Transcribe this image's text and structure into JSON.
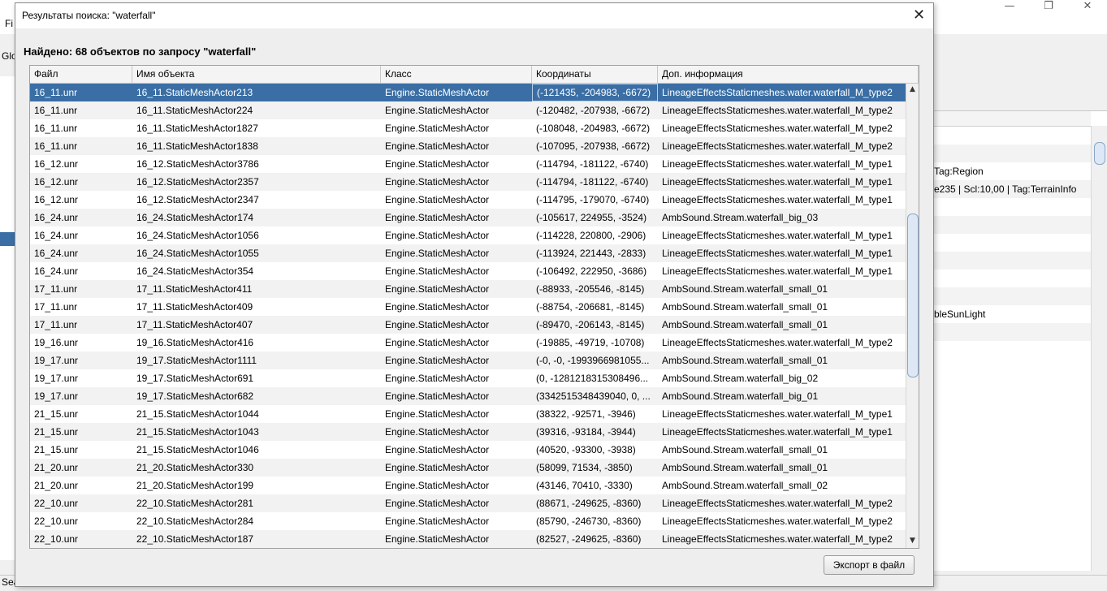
{
  "background": {
    "menu_file": "Fi",
    "toolbar_text": "Glo",
    "status_text": "Sea",
    "window_controls": [
      "—",
      "❐",
      "✕"
    ],
    "right_panel_rows": [
      {
        "text": "",
        "alt": false
      },
      {
        "text": "",
        "alt": true
      },
      {
        "text": "Tag:Region",
        "alt": false
      },
      {
        "text": "e235 | Scl:10,00 | Tag:TerrainInfo",
        "alt": true
      },
      {
        "text": "",
        "alt": false
      },
      {
        "text": "",
        "alt": true
      },
      {
        "text": "",
        "alt": false
      },
      {
        "text": "",
        "alt": true
      },
      {
        "text": "",
        "alt": false
      },
      {
        "text": "",
        "alt": true
      },
      {
        "text": "bleSunLight",
        "alt": false
      },
      {
        "text": "",
        "alt": true
      }
    ]
  },
  "dialog": {
    "title": "Результаты поиска: \"waterfall\"",
    "close_icon": "✕",
    "heading": "Найдено: 68 объектов по запросу \"waterfall\"",
    "export_label": "Экспорт в файл"
  },
  "table": {
    "columns": [
      "Файл",
      "Имя объекта",
      "Класс",
      "Координаты",
      "Доп. информация"
    ],
    "selected_row": 0,
    "rows": [
      [
        "16_11.unr",
        "16_11.StaticMeshActor213",
        "Engine.StaticMeshActor",
        "(-121435, -204983, -6672)",
        "LineageEffectsStaticmeshes.water.waterfall_M_type2"
      ],
      [
        "16_11.unr",
        "16_11.StaticMeshActor224",
        "Engine.StaticMeshActor",
        "(-120482, -207938, -6672)",
        "LineageEffectsStaticmeshes.water.waterfall_M_type2"
      ],
      [
        "16_11.unr",
        "16_11.StaticMeshActor1827",
        "Engine.StaticMeshActor",
        "(-108048, -204983, -6672)",
        "LineageEffectsStaticmeshes.water.waterfall_M_type2"
      ],
      [
        "16_11.unr",
        "16_11.StaticMeshActor1838",
        "Engine.StaticMeshActor",
        "(-107095, -207938, -6672)",
        "LineageEffectsStaticmeshes.water.waterfall_M_type2"
      ],
      [
        "16_12.unr",
        "16_12.StaticMeshActor3786",
        "Engine.StaticMeshActor",
        "(-114794, -181122, -6740)",
        "LineageEffectsStaticmeshes.water.waterfall_M_type1"
      ],
      [
        "16_12.unr",
        "16_12.StaticMeshActor2357",
        "Engine.StaticMeshActor",
        "(-114794, -181122, -6740)",
        "LineageEffectsStaticmeshes.water.waterfall_M_type1"
      ],
      [
        "16_12.unr",
        "16_12.StaticMeshActor2347",
        "Engine.StaticMeshActor",
        "(-114795, -179070, -6740)",
        "LineageEffectsStaticmeshes.water.waterfall_M_type1"
      ],
      [
        "16_24.unr",
        "16_24.StaticMeshActor174",
        "Engine.StaticMeshActor",
        "(-105617, 224955, -3524)",
        "AmbSound.Stream.waterfall_big_03"
      ],
      [
        "16_24.unr",
        "16_24.StaticMeshActor1056",
        "Engine.StaticMeshActor",
        "(-114228, 220800, -2906)",
        "LineageEffectsStaticmeshes.water.waterfall_M_type1"
      ],
      [
        "16_24.unr",
        "16_24.StaticMeshActor1055",
        "Engine.StaticMeshActor",
        "(-113924, 221443, -2833)",
        "LineageEffectsStaticmeshes.water.waterfall_M_type1"
      ],
      [
        "16_24.unr",
        "16_24.StaticMeshActor354",
        "Engine.StaticMeshActor",
        "(-106492, 222950, -3686)",
        "LineageEffectsStaticmeshes.water.waterfall_M_type1"
      ],
      [
        "17_11.unr",
        "17_11.StaticMeshActor411",
        "Engine.StaticMeshActor",
        "(-88933, -205546, -8145)",
        "AmbSound.Stream.waterfall_small_01"
      ],
      [
        "17_11.unr",
        "17_11.StaticMeshActor409",
        "Engine.StaticMeshActor",
        "(-88754, -206681, -8145)",
        "AmbSound.Stream.waterfall_small_01"
      ],
      [
        "17_11.unr",
        "17_11.StaticMeshActor407",
        "Engine.StaticMeshActor",
        "(-89470, -206143, -8145)",
        "AmbSound.Stream.waterfall_small_01"
      ],
      [
        "19_16.unr",
        "19_16.StaticMeshActor416",
        "Engine.StaticMeshActor",
        "(-19885, -49719, -10708)",
        "LineageEffectsStaticmeshes.water.waterfall_M_type2"
      ],
      [
        "19_17.unr",
        "19_17.StaticMeshActor1111",
        "Engine.StaticMeshActor",
        "(-0, -0, -1993966981055...",
        "AmbSound.Stream.waterfall_small_01"
      ],
      [
        "19_17.unr",
        "19_17.StaticMeshActor691",
        "Engine.StaticMeshActor",
        "(0, -1281218315308496...",
        "AmbSound.Stream.waterfall_big_02"
      ],
      [
        "19_17.unr",
        "19_17.StaticMeshActor682",
        "Engine.StaticMeshActor",
        "(3342515348439040, 0, ...",
        "AmbSound.Stream.waterfall_big_01"
      ],
      [
        "21_15.unr",
        "21_15.StaticMeshActor1044",
        "Engine.StaticMeshActor",
        "(38322, -92571, -3946)",
        "LineageEffectsStaticmeshes.water.waterfall_M_type1"
      ],
      [
        "21_15.unr",
        "21_15.StaticMeshActor1043",
        "Engine.StaticMeshActor",
        "(39316, -93184, -3944)",
        "LineageEffectsStaticmeshes.water.waterfall_M_type1"
      ],
      [
        "21_15.unr",
        "21_15.StaticMeshActor1046",
        "Engine.StaticMeshActor",
        "(40520, -93300, -3938)",
        "AmbSound.Stream.waterfall_small_01"
      ],
      [
        "21_20.unr",
        "21_20.StaticMeshActor330",
        "Engine.StaticMeshActor",
        "(58099, 71534, -3850)",
        "AmbSound.Stream.waterfall_small_01"
      ],
      [
        "21_20.unr",
        "21_20.StaticMeshActor199",
        "Engine.StaticMeshActor",
        "(43146, 70410, -3330)",
        "AmbSound.Stream.waterfall_small_02"
      ],
      [
        "22_10.unr",
        "22_10.StaticMeshActor281",
        "Engine.StaticMeshActor",
        "(88671, -249625, -8360)",
        "LineageEffectsStaticmeshes.water.waterfall_M_type2"
      ],
      [
        "22_10.unr",
        "22_10.StaticMeshActor284",
        "Engine.StaticMeshActor",
        "(85790, -246730, -8360)",
        "LineageEffectsStaticmeshes.water.waterfall_M_type2"
      ],
      [
        "22_10.unr",
        "22_10.StaticMeshActor187",
        "Engine.StaticMeshActor",
        "(82527, -249625, -8360)",
        "LineageEffectsStaticmeshes.water.waterfall_M_type2"
      ]
    ]
  },
  "scrollbar": {
    "up_icon": "▲",
    "down_icon": "▼"
  }
}
